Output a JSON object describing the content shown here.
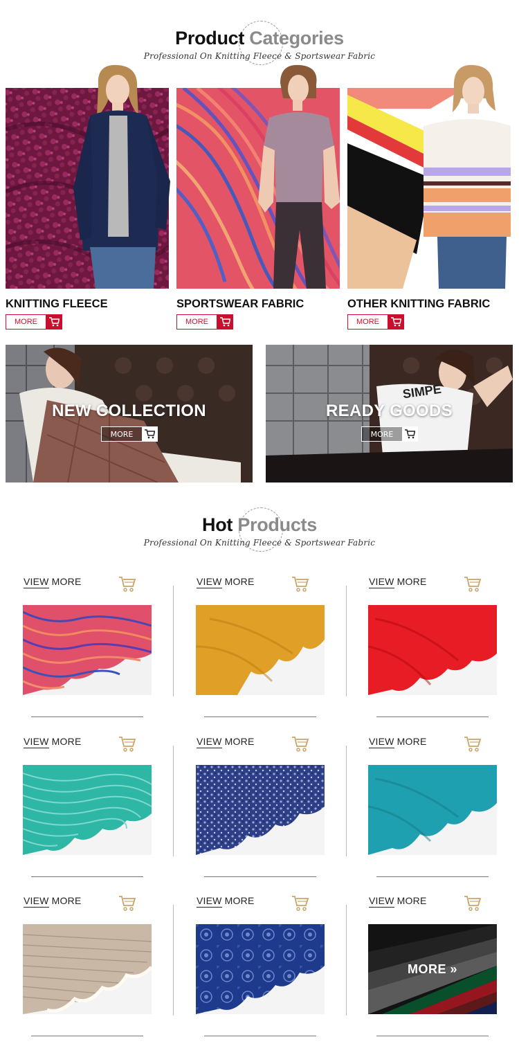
{
  "categories_section": {
    "title_dark": "Product",
    "title_light": "Categories",
    "subtitle": "Professional On Knitting Fleece & Sportswear Fabric"
  },
  "categories": [
    {
      "name": "KNITTING FLEECE",
      "more": "MORE"
    },
    {
      "name": "SPORTSWEAR FABRIC",
      "more": "MORE"
    },
    {
      "name": "OTHER KNITTING FABRIC",
      "more": "MORE"
    }
  ],
  "banners": [
    {
      "title": "NEW COLLECTION",
      "more": "MORE"
    },
    {
      "title": "READY GOODS",
      "more": "MORE",
      "shirt_text": "SIMPE"
    }
  ],
  "hot_section": {
    "title_dark": "Hot",
    "title_light": "Products",
    "subtitle": "Professional On Knitting Fleece & Sportswear Fabric"
  },
  "products": [
    {
      "view_a": "VIEW",
      "view_b": " MORE",
      "fabric": "space-dye-red"
    },
    {
      "view_a": "VIEW",
      "view_b": " MORE",
      "fabric": "mustard"
    },
    {
      "view_a": "VIEW",
      "view_b": " MORE",
      "fabric": "red"
    },
    {
      "view_a": "VIEW",
      "view_b": " MORE",
      "fabric": "teal-rib"
    },
    {
      "view_a": "VIEW",
      "view_b": " MORE",
      "fabric": "navy-marl"
    },
    {
      "view_a": "VIEW",
      "view_b": " MORE",
      "fabric": "teal"
    },
    {
      "view_a": "VIEW",
      "view_b": " MORE",
      "fabric": "beige-sherpa"
    },
    {
      "view_a": "VIEW",
      "view_b": " MORE",
      "fabric": "blue-print"
    },
    {
      "view_a": "VIEW",
      "view_b": " MORE",
      "fabric": "multicolor",
      "overlay": "MORE »"
    }
  ],
  "colors": {
    "accent_red": "#c8102e",
    "heading_gray": "#8a8a8a",
    "cart_gold": "#c9a46a"
  }
}
